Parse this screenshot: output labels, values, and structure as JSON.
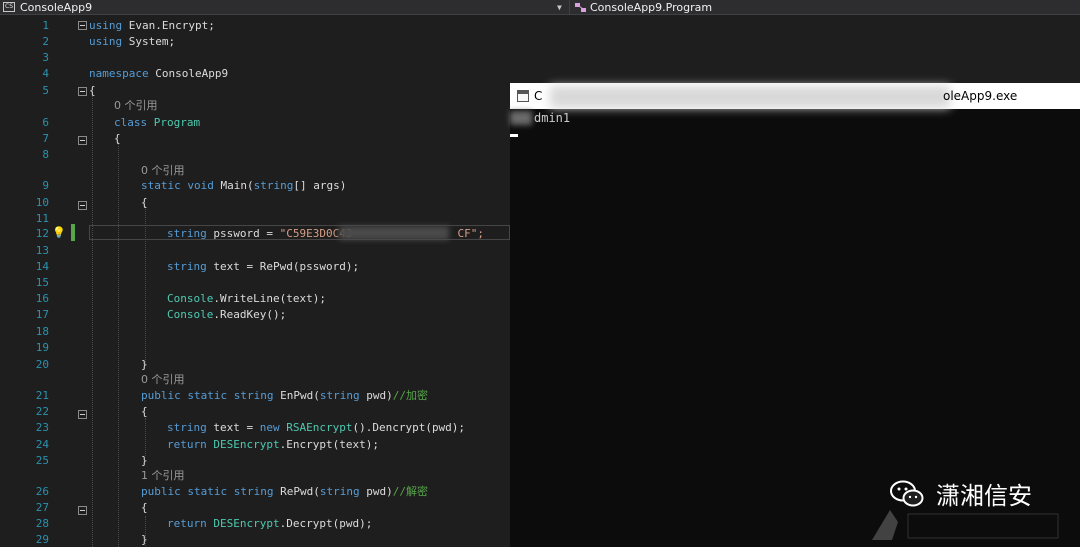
{
  "navbar": {
    "project": "ConsoleApp9",
    "class": "ConsoleApp9.Program",
    "project_icon": "CS"
  },
  "editor": {
    "lines": [
      {
        "n": "1"
      },
      {
        "n": "2"
      },
      {
        "n": "3"
      },
      {
        "n": "4"
      },
      {
        "n": "5"
      },
      {
        "n": "6"
      },
      {
        "n": "7"
      },
      {
        "n": "8"
      },
      {
        "n": "9"
      },
      {
        "n": "10"
      },
      {
        "n": "11"
      },
      {
        "n": "12"
      },
      {
        "n": "13"
      },
      {
        "n": "14"
      },
      {
        "n": "15"
      },
      {
        "n": "16"
      },
      {
        "n": "17"
      },
      {
        "n": "18"
      },
      {
        "n": "19"
      },
      {
        "n": "20"
      },
      {
        "n": "21"
      },
      {
        "n": "22"
      },
      {
        "n": "23"
      },
      {
        "n": "24"
      },
      {
        "n": "25"
      },
      {
        "n": "26"
      },
      {
        "n": "27"
      },
      {
        "n": "28"
      },
      {
        "n": "29"
      }
    ],
    "code": {
      "l1_kw": "using",
      "l1_rest": " Evan.Encrypt;",
      "l2_kw": "using",
      "l2_rest": " System;",
      "l4_kw": "namespace",
      "l4_rest": " ConsoleApp9",
      "l5": "{",
      "ref0_a": "0 个引用",
      "l6_kw": "class",
      "l6_ty": "Program",
      "l7": "{",
      "ref0_b": "0 个引用",
      "l9_kw1": "static",
      "l9_kw2": "void",
      "l9_name": " Main(",
      "l9_kw3": "string",
      "l9_rest": "[] args)",
      "l10": "{",
      "l12_kw": "string",
      "l12_name": " pssword = ",
      "l12_str_a": "\"C59E3D0C43",
      "l12_str_b": "CF\";",
      "l14_kw": "string",
      "l14_rest": " text = RePwd(pssword);",
      "l16_ty": "Console",
      "l16_rest": ".WriteLine(text);",
      "l17_ty": "Console",
      "l17_rest": ".ReadKey();",
      "l20": "}",
      "ref0_c": "0 个引用",
      "l21_kw1": "public",
      "l21_kw2": "static",
      "l21_kw3": "string",
      "l21_name": " EnPwd(",
      "l21_kw4": "string",
      "l21_rest": " pwd)",
      "l21_cm": "//加密",
      "l22": "{",
      "l23_kw": "string",
      "l23_mid": " text = ",
      "l23_kw2": "new",
      "l23_ty": " RSAEncrypt",
      "l23_rest": "().Dencrypt(pwd);",
      "l24_kw": "return",
      "l24_ty": " DESEncrypt",
      "l24_rest": ".Encrypt(text);",
      "l25": "}",
      "ref1": "1 个引用",
      "l26_kw1": "public",
      "l26_kw2": "static",
      "l26_kw3": "string",
      "l26_name": " RePwd(",
      "l26_kw4": "string",
      "l26_rest": " pwd)",
      "l26_cm": "//解密",
      "l27": "{",
      "l28_kw": "return",
      "l28_ty": " DESEncrypt",
      "l28_rest": ".Decrypt(pwd);",
      "l29": "}"
    }
  },
  "console": {
    "title_start": "C",
    "title_end": "oleApp9.exe",
    "output": "dmin1"
  },
  "watermark": {
    "text": "潇湘信安"
  },
  "colors": {
    "keyword": "#569cd6",
    "type": "#4ec9b0",
    "string": "#d69d85",
    "comment": "#57a64a",
    "line_number": "#2b91af"
  }
}
